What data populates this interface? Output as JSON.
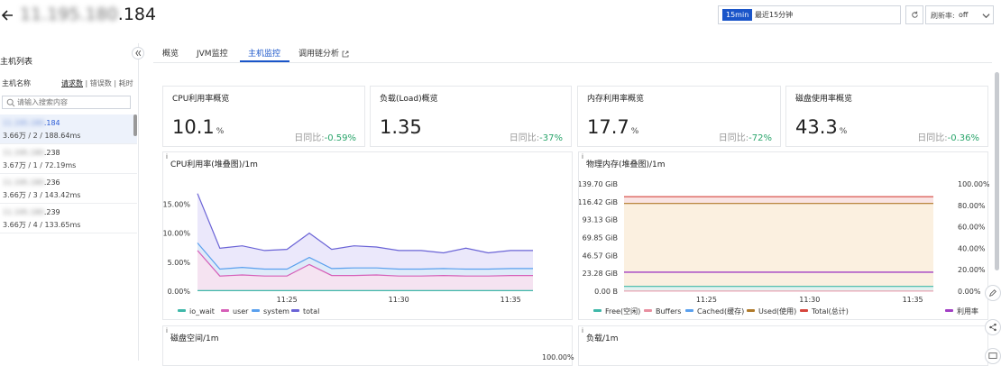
{
  "header": {
    "host_ip_hidden": "11.195.180",
    "host_ip_suffix": ".184",
    "time_badge": "15min",
    "time_range": "最近15分钟",
    "refresh_label": "刷新率:",
    "refresh_value": "off"
  },
  "sidebar": {
    "title": "主机列表",
    "col_name": "主机名称",
    "sort_requests": "请求数",
    "sort_errors": "错误数",
    "sort_latency": "耗时",
    "search_placeholder": "请输入搜索内容",
    "hosts": [
      {
        "ip_hidden": "11.195.180",
        "ip_suffix": ".184",
        "stats": "3.66万 / 2 / 188.64ms",
        "selected": true
      },
      {
        "ip_hidden": "11.195.180",
        "ip_suffix": ".238",
        "stats": "3.67万 / 1 / 72.19ms",
        "selected": false
      },
      {
        "ip_hidden": "11.195.180",
        "ip_suffix": ".236",
        "stats": "3.66万 / 3 / 143.42ms",
        "selected": false
      },
      {
        "ip_hidden": "11.195.180",
        "ip_suffix": ".239",
        "stats": "3.66万 / 4 / 133.65ms",
        "selected": false
      }
    ]
  },
  "tabs": [
    {
      "label": "概览",
      "active": false
    },
    {
      "label": "JVM监控",
      "active": false
    },
    {
      "label": "主机监控",
      "active": true
    },
    {
      "label": "调用链分析",
      "active": false
    }
  ],
  "cards": [
    {
      "title": "CPU利用率概览",
      "value": "10.1",
      "unit": "%",
      "cmp_label": "日同比:",
      "delta": "-0.59%"
    },
    {
      "title": "负载(Load)概览",
      "value": "1.35",
      "unit": "",
      "cmp_label": "日同比:",
      "delta": "-37%"
    },
    {
      "title": "内存利用率概览",
      "value": "17.7",
      "unit": "%",
      "cmp_label": "日同比:",
      "delta": "-72%"
    },
    {
      "title": "磁盘使用率概览",
      "value": "43.3",
      "unit": "%",
      "cmp_label": "日同比:",
      "delta": "-0.36%"
    }
  ],
  "colors": {
    "accent": "#1a55c9",
    "positive": "#2aa56b"
  },
  "panels": {
    "cpu": {
      "title": "CPU利用率(堆叠图)/1m"
    },
    "mem": {
      "title": "物理内存(堆叠图)/1m"
    },
    "disk": {
      "title": "磁盘空间/1m",
      "ytick_right": "100.00%"
    },
    "load": {
      "title": "负载/1m"
    }
  },
  "chart_data": [
    {
      "type": "area",
      "title": "CPU利用率(堆叠图)/1m",
      "x": [
        "11:21",
        "11:22",
        "11:23",
        "11:24",
        "11:25",
        "11:26",
        "11:27",
        "11:28",
        "11:29",
        "11:30",
        "11:31",
        "11:32",
        "11:33",
        "11:34",
        "11:35",
        "11:36"
      ],
      "xticks": [
        "11:25",
        "11:30",
        "11:35"
      ],
      "yticks": [
        "0.00%",
        "5.00%",
        "10.00%",
        "15.00%"
      ],
      "ylim": [
        0,
        18
      ],
      "series": [
        {
          "name": "io_wait",
          "color": "#3fb8a9",
          "values": [
            0.1,
            0.1,
            0.1,
            0.1,
            0.1,
            0.1,
            0.1,
            0.1,
            0.1,
            0.1,
            0.1,
            0.1,
            0.1,
            0.1,
            0.1,
            0.1
          ]
        },
        {
          "name": "user",
          "color": "#d65fb8",
          "values": [
            7.0,
            2.6,
            2.8,
            2.6,
            2.6,
            4.6,
            2.7,
            2.7,
            2.8,
            2.6,
            2.6,
            2.7,
            2.6,
            2.6,
            2.7,
            2.7
          ]
        },
        {
          "name": "system",
          "color": "#5aa0ee",
          "values": [
            1.3,
            1.2,
            1.3,
            1.2,
            1.2,
            1.2,
            1.2,
            1.3,
            1.2,
            1.2,
            1.2,
            1.2,
            1.2,
            1.2,
            1.2,
            1.2
          ]
        },
        {
          "name": "total",
          "color": "#6a63d6",
          "values": [
            16.8,
            7.4,
            7.8,
            7.0,
            7.2,
            10.0,
            7.2,
            7.8,
            7.6,
            7.0,
            7.0,
            6.6,
            7.4,
            6.6,
            7.0,
            7.0
          ]
        }
      ],
      "legend": "bottom"
    },
    {
      "type": "area",
      "title": "物理内存(堆叠图)/1m",
      "x": [
        "11:21",
        "11:22",
        "11:23",
        "11:24",
        "11:25",
        "11:26",
        "11:27",
        "11:28",
        "11:29",
        "11:30",
        "11:31",
        "11:32",
        "11:33",
        "11:34",
        "11:35",
        "11:36"
      ],
      "xticks": [
        "11:25",
        "11:30",
        "11:35"
      ],
      "yticks_left": [
        "0.00 B",
        "23.28 GiB",
        "46.57 GiB",
        "69.85 GiB",
        "93.13 GiB",
        "116.42 GiB",
        "139.70 GiB"
      ],
      "yticks_right": [
        "0.00%",
        "20.00%",
        "40.00%",
        "60.00%",
        "80.00%",
        "100.00%"
      ],
      "series": [
        {
          "name": "Free(空闲)",
          "color": "#3fb8a9",
          "values_gib": [
            108,
            108,
            108,
            108,
            108,
            108,
            108,
            108,
            108,
            108,
            108,
            108,
            108,
            108,
            108,
            108
          ]
        },
        {
          "name": "Buffers",
          "color": "#e88fa0",
          "values_gib": [
            0.1,
            0.1,
            0.1,
            0.1,
            0.1,
            0.1,
            0.1,
            0.1,
            0.1,
            0.1,
            0.1,
            0.1,
            0.1,
            0.1,
            0.1,
            0.1
          ]
        },
        {
          "name": "Cached(缓存)",
          "color": "#5aa0ee",
          "values_gib": [
            2.8,
            2.8,
            2.8,
            2.8,
            2.8,
            2.8,
            2.8,
            2.8,
            2.8,
            2.8,
            2.8,
            2.8,
            2.8,
            2.8,
            2.8,
            2.8
          ]
        },
        {
          "name": "Used(使用)",
          "color": "#b07a2a",
          "values_gib": [
            3.4,
            3.4,
            3.4,
            3.4,
            3.4,
            3.4,
            3.4,
            3.4,
            3.4,
            3.4,
            3.4,
            3.4,
            3.4,
            3.4,
            3.4,
            3.4
          ]
        },
        {
          "name": "Total(总计)",
          "color": "#d6453d",
          "values_gib": [
            123,
            123,
            123,
            123,
            123,
            123,
            123,
            123,
            123,
            123,
            123,
            123,
            123,
            123,
            123,
            123
          ]
        },
        {
          "name": "利用率",
          "color": "#a23fc4",
          "values_pct": [
            17.7,
            17.7,
            17.7,
            17.7,
            17.7,
            17.7,
            17.7,
            17.7,
            17.7,
            17.7,
            17.7,
            17.7,
            17.7,
            17.7,
            17.7,
            17.7
          ]
        }
      ],
      "legend": "bottom"
    }
  ]
}
